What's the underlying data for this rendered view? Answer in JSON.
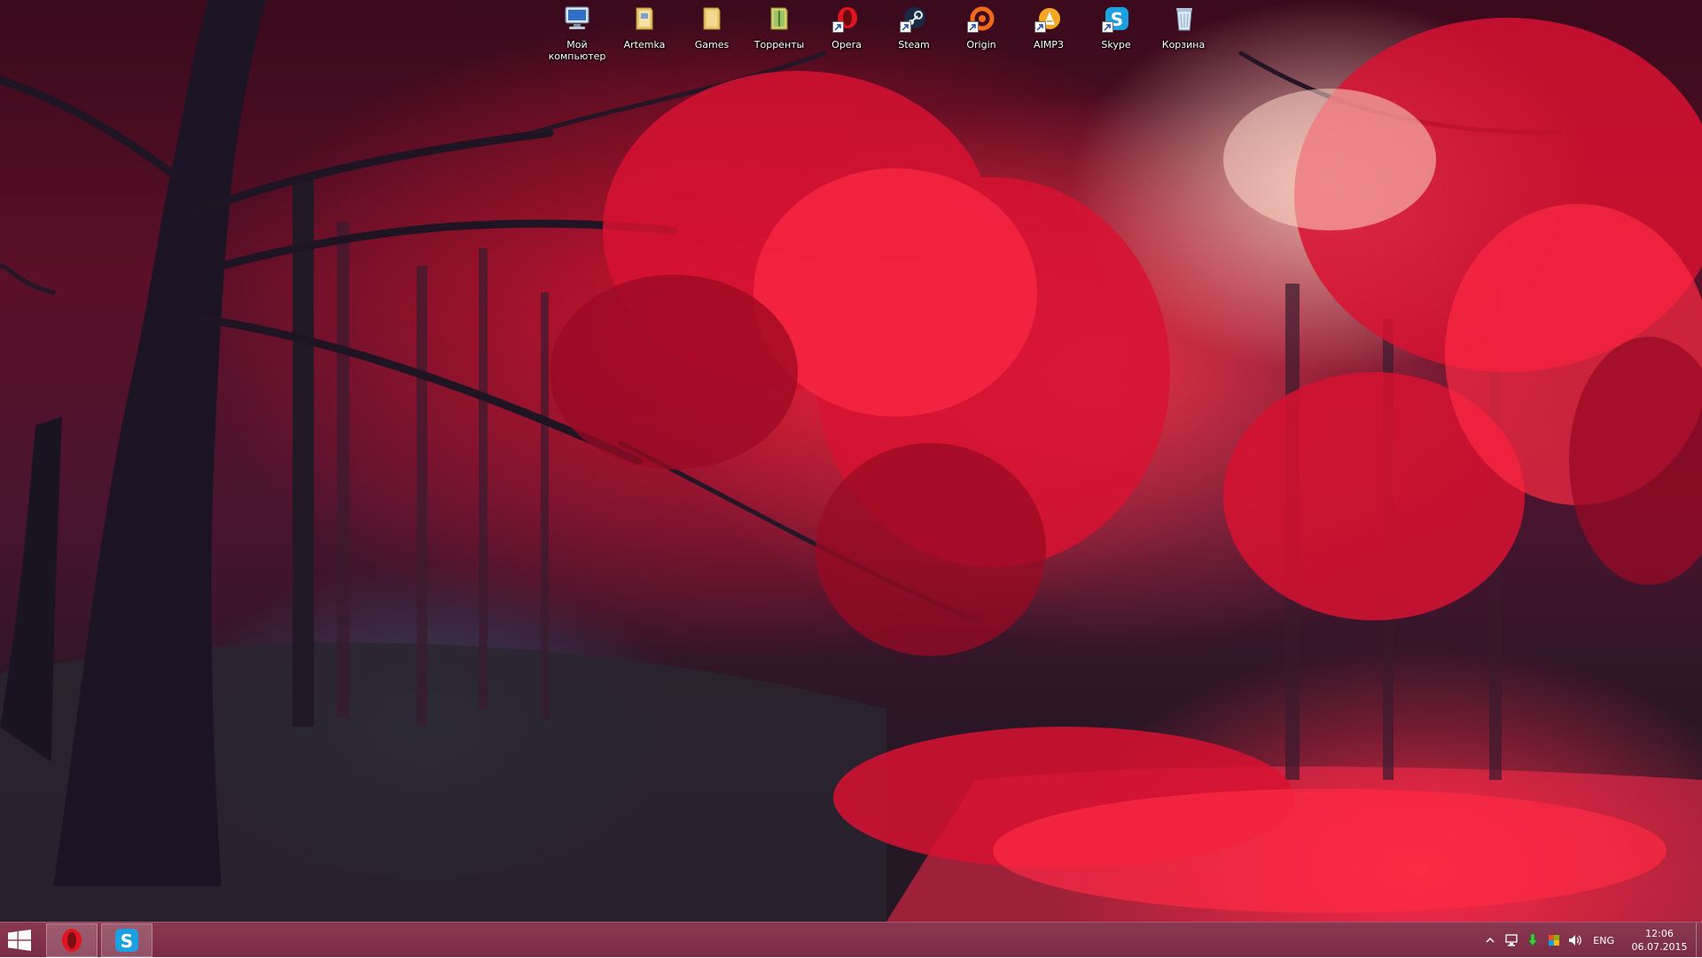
{
  "desktop": {
    "wallpaper": "red-autumn-forest",
    "icons": [
      {
        "label": "Мой\nкомпьютер",
        "icon": "computer-icon"
      },
      {
        "label": "Artemka",
        "icon": "folder-icon"
      },
      {
        "label": "Games",
        "icon": "folder-icon"
      },
      {
        "label": "Торренты",
        "icon": "archive-folder-icon"
      },
      {
        "label": "Opera",
        "icon": "opera-icon"
      },
      {
        "label": "Steam",
        "icon": "steam-icon"
      },
      {
        "label": "Origin",
        "icon": "origin-icon"
      },
      {
        "label": "AIMP3",
        "icon": "aimp-icon"
      },
      {
        "label": "Skype",
        "icon": "skype-icon"
      },
      {
        "label": "Корзина",
        "icon": "recycle-bin-icon"
      }
    ]
  },
  "taskbar": {
    "color": "#7f3049",
    "start_icon": "windows-logo-icon",
    "pinned": [
      {
        "name": "Opera",
        "icon": "opera-icon",
        "color": "#e3141f"
      },
      {
        "name": "Skype",
        "icon": "skype-icon",
        "color": "#1ba1e2"
      }
    ],
    "tray": {
      "icons": [
        "show-hidden-icons-chevron",
        "network-icon",
        "download-arrow-icon",
        "flag-icon",
        "volume-icon"
      ],
      "language": "ENG",
      "time": "12:06",
      "date": "06.07.2015"
    }
  }
}
